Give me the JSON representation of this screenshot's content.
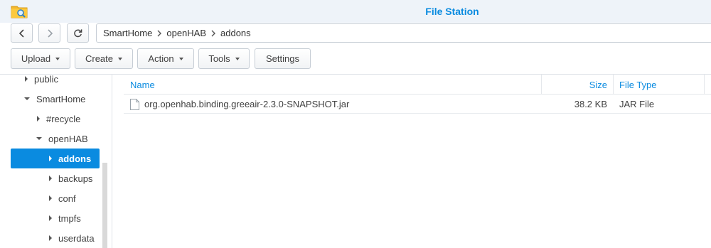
{
  "window": {
    "title": "File Station",
    "app_icon": "folder-search-icon"
  },
  "nav": {
    "back_icon": "chevron-left-icon",
    "forward_icon": "chevron-right-icon",
    "refresh_icon": "refresh-icon",
    "breadcrumbs": [
      "SmartHome",
      "openHAB",
      "addons"
    ]
  },
  "toolbar": {
    "upload": "Upload",
    "create": "Create",
    "action": "Action",
    "tools": "Tools",
    "settings": "Settings"
  },
  "tree": {
    "items": [
      {
        "label": "public",
        "expanded": false
      },
      {
        "label": "SmartHome",
        "expanded": true
      },
      {
        "label": "#recycle",
        "expanded": false
      },
      {
        "label": "openHAB",
        "expanded": true
      },
      {
        "label": "addons",
        "expanded": false,
        "selected": true
      },
      {
        "label": "backups",
        "expanded": false
      },
      {
        "label": "conf",
        "expanded": false
      },
      {
        "label": "tmpfs",
        "expanded": false
      },
      {
        "label": "userdata",
        "expanded": false
      }
    ]
  },
  "table": {
    "columns": [
      "Name",
      "Size",
      "File Type"
    ],
    "rows": [
      {
        "name": "org.openhab.binding.greeair-2.3.0-SNAPSHOT.jar",
        "size": "38.2 KB",
        "type": "JAR File",
        "icon": "file-icon"
      }
    ]
  },
  "colors": {
    "accent": "#0a8be0",
    "titlebar": "#eef3f9"
  }
}
